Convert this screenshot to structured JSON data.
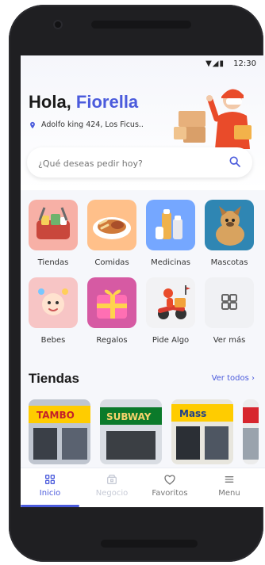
{
  "status": {
    "icons": "▼◢▮",
    "time": "12:30"
  },
  "header": {
    "greeting": "Hola,",
    "name": "Fiorella",
    "address": "Adolfo king 424, Los Ficus.."
  },
  "search": {
    "placeholder": "¿Qué deseas pedir hoy?"
  },
  "categories": [
    {
      "label": "Tiendas",
      "icon": "store-basket-icon",
      "bg": "#f7b0a6"
    },
    {
      "label": "Comidas",
      "icon": "food-plate-icon",
      "bg": "#ffc08a"
    },
    {
      "label": "Medicinas",
      "icon": "medicine-bottles-icon",
      "bg": "#75a7ff"
    },
    {
      "label": "Mascotas",
      "icon": "dog-icon",
      "bg": "#2f86b3"
    },
    {
      "label": "Bebes",
      "icon": "baby-icon",
      "bg": "#f7c5c5"
    },
    {
      "label": "Regalos",
      "icon": "gift-icon",
      "bg": "#d65aa3"
    },
    {
      "label": "Pide Algo",
      "icon": "delivery-scooter-icon",
      "bg": "#f2f2f4"
    },
    {
      "label": "Ver más",
      "icon": "grid-icon",
      "bg": "#f0f1f4"
    }
  ],
  "stores_section": {
    "title": "Tiendas",
    "see_all": "Ver todos"
  },
  "stores": [
    {
      "name": "TAMBO",
      "icon": "tambo-store-icon",
      "accent": "#ffcc00"
    },
    {
      "name": "SUBWAY",
      "icon": "subway-store-icon",
      "accent": "#0b7a2a"
    },
    {
      "name": "Mass",
      "icon": "mass-store-icon",
      "accent": "#1d3f8a"
    },
    {
      "name": "",
      "icon": "store-partial-icon",
      "accent": "#d7262e"
    }
  ],
  "nav": [
    {
      "label": "Inicio",
      "icon": "home-grid-icon",
      "active": true
    },
    {
      "label": "Negocio",
      "icon": "business-icon",
      "active": false
    },
    {
      "label": "Favoritos",
      "icon": "heart-icon",
      "active": false
    },
    {
      "label": "Menu",
      "icon": "menu-icon",
      "active": false
    }
  ],
  "colors": {
    "accent": "#4b5bdc"
  }
}
